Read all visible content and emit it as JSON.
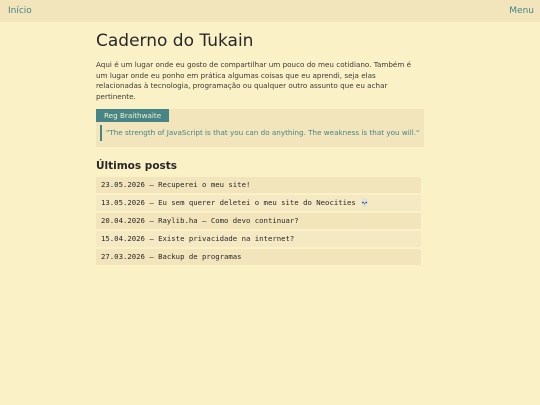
{
  "nav": {
    "home_label": "Início",
    "menu_label": "Menu"
  },
  "main": {
    "title": "Caderno do Tukain",
    "intro": "Aqui é um lugar onde eu gosto de compartilhar um pouco do meu cotidiano. Também é um lugar onde eu ponho em prática algumas coisas que eu aprendi, seja elas relacionadas à tecnologia, programação ou qualquer outro assunto que eu achar pertinente."
  },
  "quote": {
    "author": "Reg Braithwaite",
    "text": "\"The strength of JavaScript is that you can do anything. The weakness is that you will.\""
  },
  "posts": {
    "heading": "Últimos posts",
    "items": [
      "23.05.2026 – Recuperei o meu site!",
      "13.05.2026 – Eu sem querer deletei o meu site do Neocities 💀",
      "20.04.2026 – Raylib.ha – Como devo continuar?",
      "15.04.2026 – Existe privacidade na internet?",
      "27.03.2026 – Backup de programas"
    ]
  },
  "colors": {
    "background": "#fbf1c7",
    "bar": "#f2e5bc",
    "accent": "#458588",
    "text": "#3c3836"
  }
}
